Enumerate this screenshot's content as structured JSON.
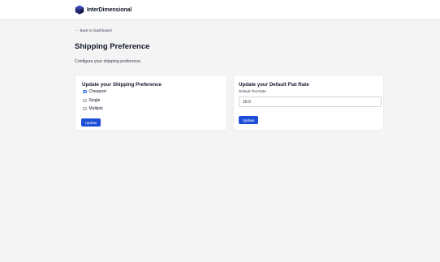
{
  "brand": {
    "logo_text": "InterDimensional",
    "logo_icon": "cube-icon"
  },
  "nav": {
    "back_label": "Back to Dashboard"
  },
  "page": {
    "title": "Shipping Preference",
    "description": "Configure your shipping preference."
  },
  "shipping_card": {
    "title": "Update your Shipping Preference",
    "options": [
      {
        "label": "Cheapest",
        "checked": true
      },
      {
        "label": "Single",
        "checked": false
      },
      {
        "label": "Multiple",
        "checked": false
      }
    ],
    "button_label": "Update"
  },
  "flat_rate_card": {
    "title": "Update your Default Flat Rate",
    "field_label": "Default Flat Rate",
    "field_value": "10.0",
    "button_label": "Update"
  },
  "colors": {
    "primary": "#1d4ed8",
    "background": "#f4f4f5",
    "card": "#ffffff"
  }
}
